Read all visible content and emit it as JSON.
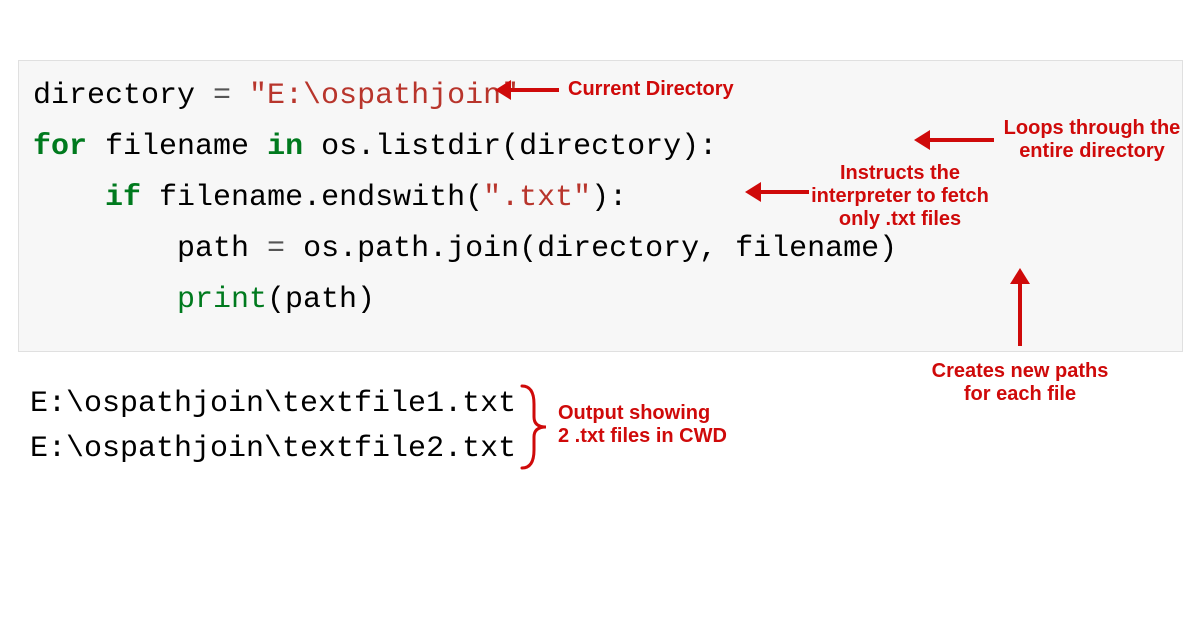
{
  "code": {
    "line1": {
      "var": "directory",
      "op": " = ",
      "str": "\"E:\\ospathjoin\""
    },
    "line2": {
      "kw1": "for",
      "sp1": " ",
      "var1": "filename",
      "sp2": " ",
      "kw2": "in",
      "sp3": " ",
      "call": "os.listdir(directory):"
    },
    "line3": {
      "indent": "    ",
      "kw": "if",
      "sp": " ",
      "expr": "filename.endswith(",
      "str": "\".txt\"",
      "close": "):"
    },
    "line4": {
      "indent": "        ",
      "lhs": "path",
      "op": " = ",
      "rhs": "os.path.join(directory, filename)"
    },
    "line5": {
      "indent": "        ",
      "fn": "print",
      "rest": "(path)"
    }
  },
  "output": {
    "line1": "E:\\ospathjoin\\textfile1.txt",
    "line2": "E:\\ospathjoin\\textfile2.txt"
  },
  "annotations": {
    "current_dir": "Current Directory",
    "loops": "Loops through the\nentire directory",
    "instructs": "Instructs the\ninterpreter to fetch\nonly .txt files",
    "creates": "Creates new paths\nfor each file",
    "output_note": "Output showing\n2 .txt files in CWD"
  },
  "colors": {
    "anno": "#cf0a0a",
    "code_bg": "#f7f7f7",
    "keyword": "#007a1e",
    "string": "#b8352c"
  }
}
